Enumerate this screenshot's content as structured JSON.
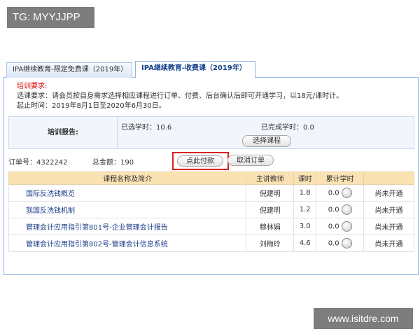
{
  "watermarks": {
    "top": "TG: MYYJJPP",
    "bottom": "www.isitdre.com"
  },
  "tabs": [
    {
      "label": "IPA继续教育-限定免费课（2019年）",
      "active": false
    },
    {
      "label": "IPA继续教育-收费课（2019年）",
      "active": true
    }
  ],
  "requirements": {
    "heading": "培训要求:",
    "line1": "选课要求：请会员按自身需求选择相应课程进行订单、付费、后台确认后即可开通学习，以18元/课时计。",
    "line2": "起止时间：2019年8月1日至2020年6月30日。"
  },
  "report": {
    "label": "培训报告:",
    "selected": "已选学时：10.6",
    "completed": "已完成学时：0.0",
    "choose_button": "选择课程"
  },
  "order": {
    "number": "订单号：4322242",
    "amount": "总金额：190",
    "pay_button": "点此付款",
    "cancel_button": "取消订单"
  },
  "table": {
    "headers": [
      "课程名称及简介",
      "主讲教师",
      "课时",
      "累计学时",
      ""
    ],
    "rows": [
      {
        "name": "国际反洗钱概览",
        "teacher": "倪建明",
        "hours": "1.8",
        "accum": "0.0",
        "status": "尚未开通"
      },
      {
        "name": "我国反洗钱机制",
        "teacher": "倪建明",
        "hours": "1.2",
        "accum": "0.0",
        "status": "尚未开通"
      },
      {
        "name": "管理会计应用指引第801号-企业管理会计报告",
        "teacher": "穆林娟",
        "hours": "3.0",
        "accum": "0.0",
        "status": "尚未开通"
      },
      {
        "name": "管理会计应用指引第802号-管理会计信息系统",
        "teacher": "刘梅玲",
        "hours": "4.6",
        "accum": "0.0",
        "status": "尚未开通"
      }
    ]
  },
  "colors": {
    "highlight_frame": "#d72222",
    "header_bg": "#fbe2b3",
    "link": "#1f3f8a",
    "tab_border": "#8db2e3"
  }
}
